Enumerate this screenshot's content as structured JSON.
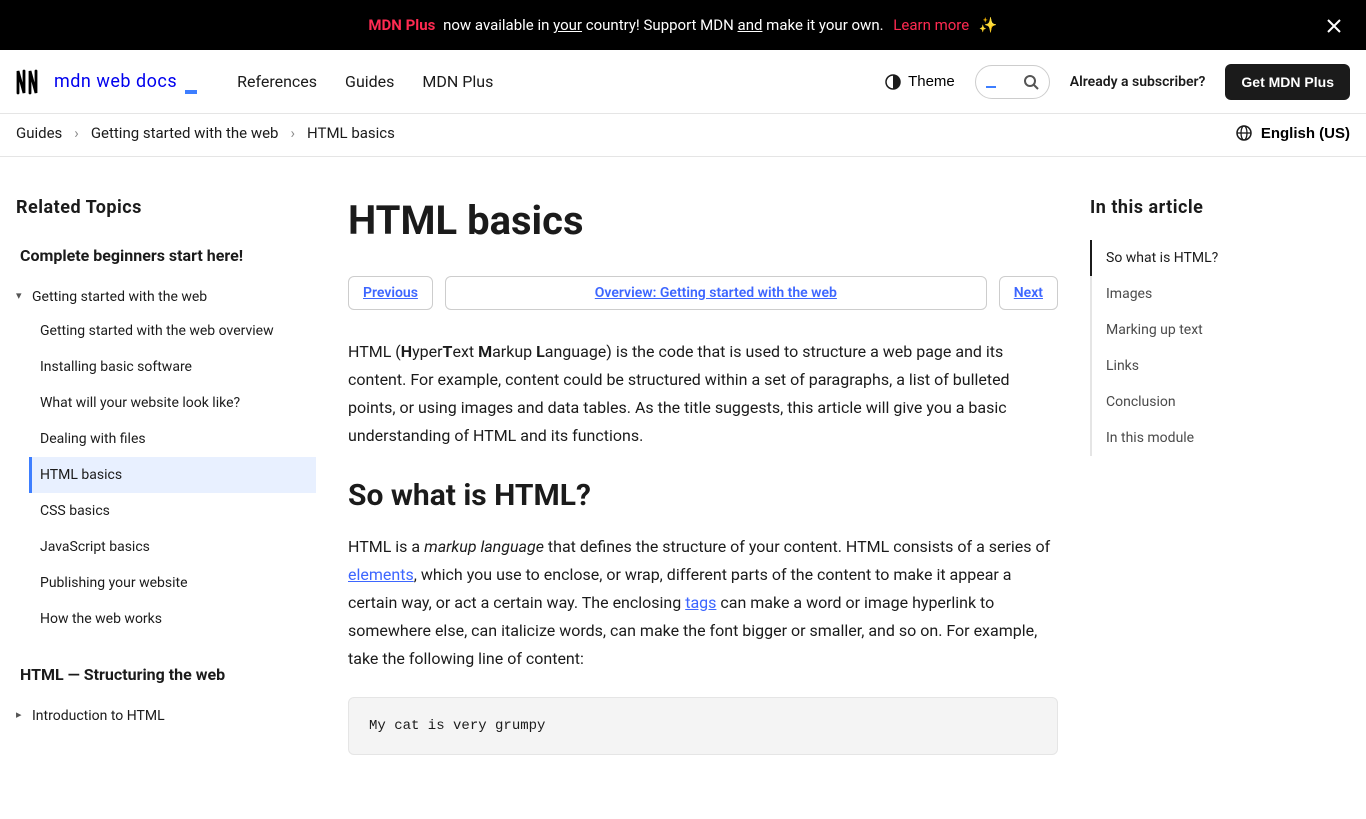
{
  "banner": {
    "brand": "MDN Plus",
    "text_before": " now available in ",
    "your": "your",
    "text_mid1": " country! Support MDN ",
    "and": "and",
    "text_mid2": " make it your own. ",
    "learn_more": "Learn more",
    "sparkle": "✨"
  },
  "header": {
    "logo_text": "mdn web docs",
    "nav": {
      "references": "References",
      "guides": "Guides",
      "plus": "MDN Plus"
    },
    "theme": "Theme",
    "subscriber": "Already a subscriber?",
    "get_plus": "Get MDN Plus"
  },
  "breadcrumbs": {
    "a": "Guides",
    "b": "Getting started with the web",
    "c": "HTML basics"
  },
  "language": "English (US)",
  "sidebar": {
    "heading": "Related Topics",
    "section1_title": "Complete beginners start here!",
    "group1_label": "Getting started with the web",
    "group1_items": [
      "Getting started with the web overview",
      "Installing basic software",
      "What will your website look like?",
      "Dealing with files",
      "HTML basics",
      "CSS basics",
      "JavaScript basics",
      "Publishing your website",
      "How the web works"
    ],
    "section2_title": "HTML — Structuring the web",
    "group2_label": "Introduction to HTML"
  },
  "article": {
    "title": "HTML basics",
    "prev": "Previous",
    "overview": "Overview: Getting started with the web",
    "next": "Next",
    "intro": {
      "pre": "HTML (",
      "h": "H",
      "tseg1": "yper",
      "t": "T",
      "tseg2": "ext ",
      "m": "M",
      "tseg3": "arkup ",
      "l": "L",
      "tseg4": "anguage) is the code that is used to structure a web page and its content. For example, content could be structured within a set of paragraphs, a list of bulleted points, or using images and data tables. As the title suggests, this article will give you a basic understanding of HTML and its functions."
    },
    "h2_so_what": "So what is HTML?",
    "p2": {
      "pre": "HTML is a ",
      "markup": "markup language",
      "seg1": " that defines the structure of your content. HTML consists of a series of ",
      "elements": "elements",
      "seg2": ", which you use to enclose, or wrap, different parts of the content to make it appear a certain way, or act a certain way. The enclosing ",
      "tags": "tags",
      "seg3": " can make a word or image hyperlink to somewhere else, can italicize words, can make the font bigger or smaller, and so on. For example, take the following line of content:"
    },
    "code1": "My cat is very grumpy"
  },
  "toc": {
    "heading": "In this article",
    "items": [
      "So what is HTML?",
      "Images",
      "Marking up text",
      "Links",
      "Conclusion",
      "In this module"
    ]
  }
}
